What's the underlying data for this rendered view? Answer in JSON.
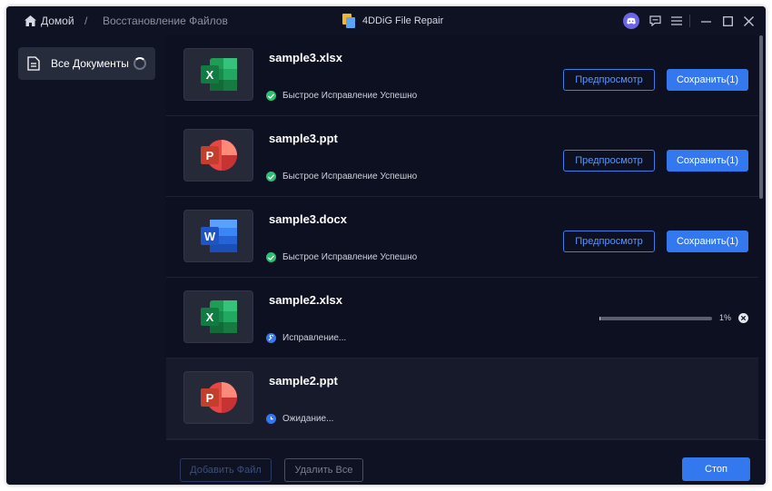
{
  "breadcrumb": {
    "home": "Домой",
    "separator": "/",
    "current": "Восстановление Файлов"
  },
  "app_title": "4DDiG File Repair",
  "window_controls": [
    "discord-icon",
    "feedback-icon",
    "menu-icon",
    "minimize-icon",
    "maximize-icon",
    "close-icon"
  ],
  "sidebar": {
    "items": [
      {
        "label": "Все Документы",
        "icon": "document-icon",
        "loading": true
      }
    ]
  },
  "files": [
    {
      "name": "sample3.xlsx",
      "type": "excel",
      "status": "Быстрое Исправление Успешно",
      "state": "done",
      "preview_label": "Предпросмотр",
      "save_label": "Сохранить(1)"
    },
    {
      "name": "sample3.ppt",
      "type": "powerpoint",
      "status": "Быстрое Исправление Успешно",
      "state": "done",
      "preview_label": "Предпросмотр",
      "save_label": "Сохранить(1)"
    },
    {
      "name": "sample3.docx",
      "type": "word",
      "status": "Быстрое Исправление Успешно",
      "state": "done",
      "preview_label": "Предпросмотр",
      "save_label": "Сохранить(1)"
    },
    {
      "name": "sample2.xlsx",
      "type": "excel",
      "status": "Исправление...",
      "state": "repairing",
      "progress": 1,
      "progress_label": "1%"
    },
    {
      "name": "sample2.ppt",
      "type": "powerpoint",
      "status": "Ожидание...",
      "state": "waiting"
    }
  ],
  "footer": {
    "add_file_label": "Добавить Файл",
    "delete_all_label": "Удалить Все",
    "stop_label": "Стоп"
  },
  "colors": {
    "accent": "#3478f0",
    "success": "#2fbf71",
    "excel": "#1f9d55",
    "powerpoint": "#e84545",
    "word": "#2f6fe0"
  }
}
